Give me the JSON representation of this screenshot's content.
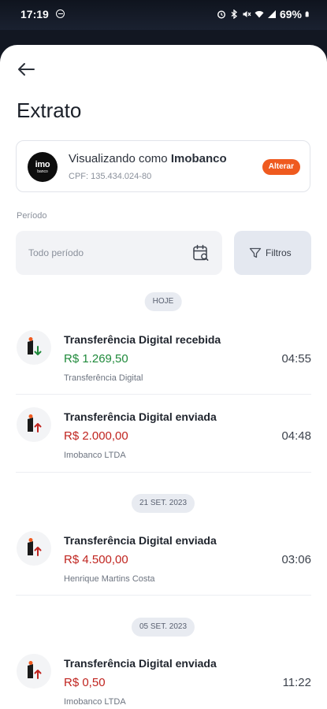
{
  "status_bar": {
    "time": "17:19",
    "battery": "69%"
  },
  "header": {
    "title": "Extrato"
  },
  "viewing": {
    "prefix": "Visualizando como ",
    "company": "Imobanco",
    "cpf": "CPF: 135.434.024-80",
    "logo_top": "imo",
    "logo_bottom": "banco",
    "change_label": "Alterar"
  },
  "period": {
    "label": "Período",
    "value": "Todo período",
    "filters_label": "Filtros"
  },
  "groups": [
    {
      "date": "HOJE",
      "transactions": [
        {
          "title": "Transferência Digital recebida",
          "amount": "R$ 1.269,50",
          "subtitle": "Transferência Digital",
          "time": "04:55",
          "direction": "in"
        },
        {
          "title": "Transferência Digital enviada",
          "amount": "R$ 2.000,00",
          "subtitle": "Imobanco LTDA",
          "time": "04:48",
          "direction": "out"
        }
      ]
    },
    {
      "date": "21 SET. 2023",
      "transactions": [
        {
          "title": "Transferência Digital enviada",
          "amount": "R$ 4.500,00",
          "subtitle": "Henrique Martins Costa",
          "time": "03:06",
          "direction": "out"
        }
      ]
    },
    {
      "date": "05 SET. 2023",
      "transactions": [
        {
          "title": "Transferência Digital enviada",
          "amount": "R$ 0,50",
          "subtitle": "Imobanco LTDA",
          "time": "11:22",
          "direction": "out"
        }
      ]
    }
  ],
  "icons": {
    "back": "arrow-left-icon",
    "calendar": "calendar-search-icon",
    "filter": "funnel-icon",
    "incoming": "arrow-down-icon",
    "outgoing": "arrow-up-icon"
  },
  "colors": {
    "accent": "#ef5a1f",
    "incoming_amount": "#1f8a3b",
    "outgoing_amount": "#c0241f",
    "brand_dark": "#0d0d0d"
  }
}
